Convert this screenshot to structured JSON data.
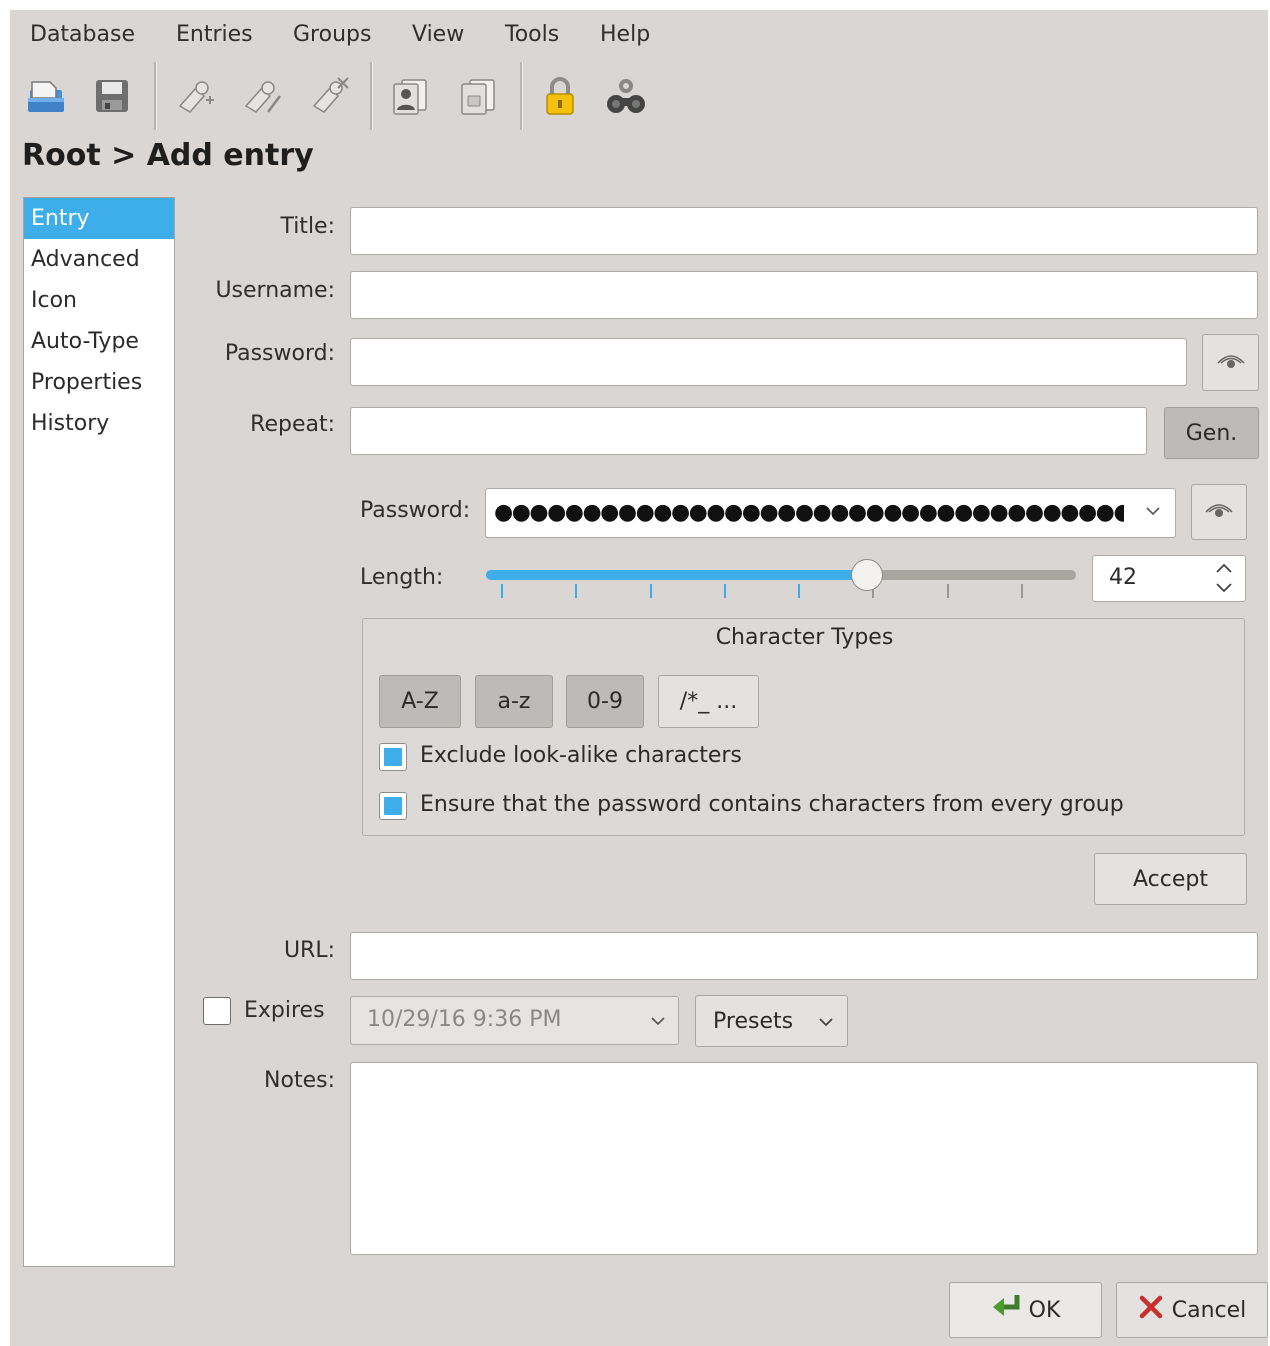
{
  "menu": [
    "Database",
    "Entries",
    "Groups",
    "View",
    "Tools",
    "Help"
  ],
  "toolbar": {
    "icons": [
      "open-database-icon",
      "save-database-icon",
      "add-entry-icon",
      "edit-entry-icon",
      "delete-entry-icon",
      "copy-username-icon",
      "copy-password-icon",
      "lock-database-icon",
      "password-generator-icon"
    ]
  },
  "breadcrumb": "Root > Add entry",
  "sidebar": {
    "items": [
      {
        "label": "Entry",
        "active": true
      },
      {
        "label": "Advanced"
      },
      {
        "label": "Icon"
      },
      {
        "label": "Auto-Type"
      },
      {
        "label": "Properties"
      },
      {
        "label": "History"
      }
    ]
  },
  "form": {
    "title_label": "Title:",
    "title_value": "",
    "username_label": "Username:",
    "username_value": "",
    "password_label": "Password:",
    "password_value": "",
    "repeat_label": "Repeat:",
    "repeat_value": "",
    "gen_button": "Gen.",
    "url_label": "URL:",
    "url_value": "",
    "expires_label": "Expires",
    "expires_checked": false,
    "expires_value": "10/29/16 9:36 PM",
    "presets_button": "Presets",
    "notes_label": "Notes:",
    "notes_value": ""
  },
  "generator": {
    "password_label": "Password:",
    "password_masked": "●●●●●●●●●●●●●●●●●●●●●●●●●●●●●●●●●●●●●●●●●●",
    "length_label": "Length:",
    "length_value": "42",
    "length_fraction": 0.645,
    "char_types_title": "Character Types",
    "char_buttons": [
      {
        "label": "A-Z",
        "pressed": true
      },
      {
        "label": "a-z",
        "pressed": true
      },
      {
        "label": "0-9",
        "pressed": true
      },
      {
        "label": "/*_ ...",
        "pressed": false
      }
    ],
    "exclude_lookalike_label": "Exclude look-alike characters",
    "exclude_lookalike_checked": true,
    "every_group_label": "Ensure that the password contains characters from every group",
    "every_group_checked": true,
    "accept_button": "Accept"
  },
  "dialog": {
    "ok_button": "OK",
    "cancel_button": "Cancel"
  },
  "colors": {
    "window_bg": "#d9d6d3",
    "accent": "#3daee9"
  }
}
